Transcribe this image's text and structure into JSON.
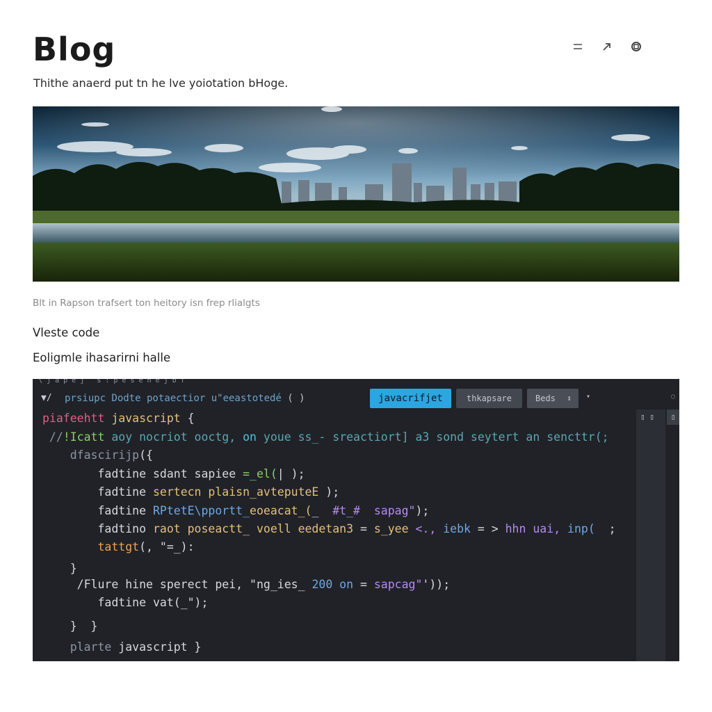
{
  "header": {
    "title": "Blog",
    "icons": [
      "menu-icon",
      "share-arrow-icon",
      "settings-circle-icon"
    ]
  },
  "subtitle": "Thithe anaerd put tn he lve yoiotation bHoge.",
  "hero_image": {
    "description_icon": "landscape-photo"
  },
  "caption": "Blt in Rapson trafsert ton heitory isn frep rlialgts",
  "section": {
    "label": "Vleste code",
    "sub": "Eoligmle ihasarirni halle"
  },
  "code_panel": {
    "top_strip": "\\  j  a  p  e  j    s : p e s e n e j b f",
    "toolbar": {
      "arrow": "▼/",
      "path_a": "prsiupc  Dodte  potaectior  ",
      "path_b": "u\"eeastotedé",
      "path_c": " ( )",
      "language_button": "javacrifjet",
      "secondary_button": "thkapsare",
      "beds_button": "Beds",
      "beds_chevron": "↕",
      "caret": "▾",
      "edge": "◌"
    },
    "scroll_top": "▯ ▯",
    "scroll_right": "▯",
    "lines": [
      {
        "tokens": [
          {
            "t": "piafeehtt ",
            "c": "c-pink"
          },
          {
            "t": "javascript",
            "c": "c-yellow"
          },
          {
            "t": " {",
            "c": "c-default"
          }
        ]
      },
      {
        "tokens": [
          {
            "t": " //",
            "c": "c-grey"
          },
          {
            "t": "!Icatt",
            "c": "c-green"
          },
          {
            "t": " aoy nocriot ooctg,",
            "c": "c-teal"
          },
          {
            "t": " on",
            "c": "c-cyan"
          },
          {
            "t": " youe ss_- sreactiort] a3 sond seytert an sencttr(;",
            "c": "c-teal"
          }
        ]
      },
      {
        "tokens": [
          {
            "t": "    dfascirijp",
            "c": "c-grey"
          },
          {
            "t": "({",
            "c": "c-default"
          }
        ]
      },
      {
        "tokens": [
          {
            "t": "        fadtine ",
            "c": "c-default"
          },
          {
            "t": "sdant",
            "c": "c-default"
          },
          {
            "t": " sapiee ",
            "c": "c-default"
          },
          {
            "t": "=_el(",
            "c": "c-green"
          },
          {
            "t": "| );",
            "c": "c-default"
          }
        ]
      },
      {
        "tokens": [
          {
            "t": "        fadtine ",
            "c": "c-default"
          },
          {
            "t": "sertecn plaisn_avteputeE",
            "c": "c-yellow"
          },
          {
            "t": " );",
            "c": "c-default"
          }
        ]
      },
      {
        "tokens": [
          {
            "t": "        fadtine ",
            "c": "c-default"
          },
          {
            "t": "RPtetE\\pportt_",
            "c": "c-blue"
          },
          {
            "t": "eoeacat_(",
            "c": "c-yellow"
          },
          {
            "t": "_  ",
            "c": "c-default"
          },
          {
            "t": "#t_#",
            "c": "c-purple"
          },
          {
            "t": "  sapag\"",
            "c": "c-purple"
          },
          {
            "t": ");",
            "c": "c-default"
          }
        ]
      },
      {
        "tokens": [
          {
            "t": "        fadtino ",
            "c": "c-default"
          },
          {
            "t": "raot poseactt_ voell eedetan3",
            "c": "c-yellow"
          },
          {
            "t": " = ",
            "c": "c-default"
          },
          {
            "t": "s_yee",
            "c": "c-yellow"
          },
          {
            "t": " <., ",
            "c": "c-purple"
          },
          {
            "t": "iebk",
            "c": "c-blue"
          },
          {
            "t": " = > ",
            "c": "c-default"
          },
          {
            "t": "hhn uai,",
            "c": "c-purple"
          },
          {
            "t": " inp(",
            "c": "c-blue"
          },
          {
            "t": "  ;",
            "c": "c-default"
          }
        ]
      },
      {
        "tokens": [
          {
            "t": "        tattgt",
            "c": "c-orange"
          },
          {
            "t": "(, \"=_):",
            "c": "c-default"
          }
        ]
      },
      {
        "tokens": [
          {
            "t": "",
            "c": "c-default"
          }
        ]
      },
      {
        "tokens": [
          {
            "t": "    }",
            "c": "c-default"
          }
        ]
      },
      {
        "tokens": [
          {
            "t": "     /",
            "c": "c-default"
          },
          {
            "t": "Flure hine sperect pei, ",
            "c": "c-default"
          },
          {
            "t": "\"ng_ies_",
            "c": "c-default"
          },
          {
            "t": " 200 on",
            "c": "c-blue"
          },
          {
            "t": " = ",
            "c": "c-default"
          },
          {
            "t": "sapcag\"",
            "c": "c-purple"
          },
          {
            "t": "'));",
            "c": "c-default"
          }
        ]
      },
      {
        "tokens": [
          {
            "t": "        fadtine ",
            "c": "c-default"
          },
          {
            "t": "vat(_\");",
            "c": "c-default"
          }
        ]
      },
      {
        "tokens": [
          {
            "t": "",
            "c": "c-default"
          }
        ]
      },
      {
        "tokens": [
          {
            "t": "    }  }",
            "c": "c-default"
          }
        ]
      },
      {
        "tokens": [
          {
            "t": "    plarte ",
            "c": "c-grey"
          },
          {
            "t": "javascript }",
            "c": "c-default"
          }
        ]
      }
    ]
  }
}
